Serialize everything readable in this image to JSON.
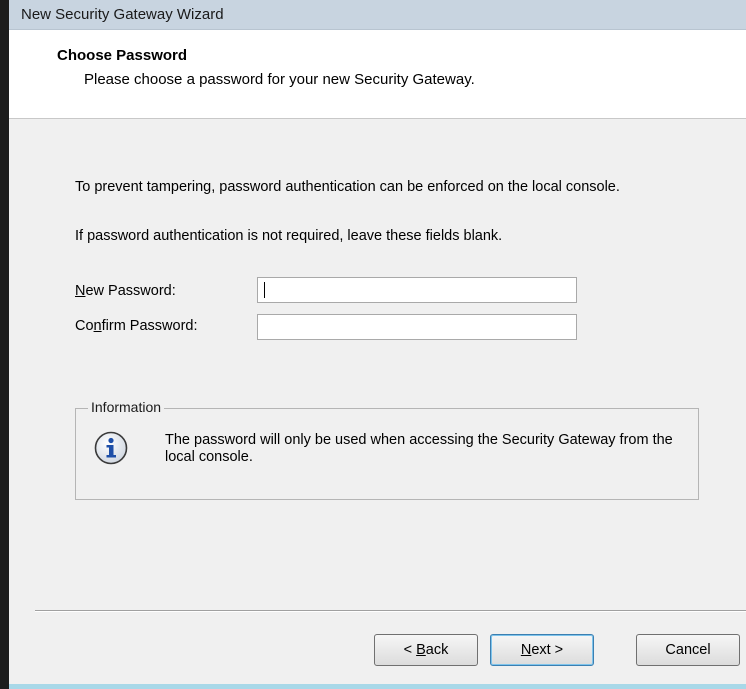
{
  "window": {
    "title": "New Security Gateway Wizard"
  },
  "header": {
    "title": "Choose Password",
    "subtitle": "Please choose a password for your new Security Gateway."
  },
  "body": {
    "line1": "To prevent tampering, password authentication can be enforced on the local console.",
    "line2": "If password authentication is not required, leave these fields blank."
  },
  "form": {
    "new_password": {
      "label_mnemonic": "N",
      "label_rest": "ew Password:",
      "value": ""
    },
    "confirm_password": {
      "label_prefix": "Co",
      "label_mnemonic": "n",
      "label_rest": "firm Password:",
      "value": ""
    }
  },
  "info": {
    "legend": "Information",
    "icon": "info-icon",
    "message": "The password will only be used when accessing the Security Gateway from the local console."
  },
  "buttons": {
    "back": {
      "prefix": "< ",
      "mnemonic": "B",
      "rest": "ack"
    },
    "next": {
      "mnemonic": "N",
      "rest": "ext >"
    },
    "cancel": {
      "label": "Cancel"
    }
  },
  "colors": {
    "title_bar": "#c8d4e0",
    "dialog_bg": "#f0f0f0",
    "info_icon_blue": "#1e4fa8",
    "default_button_border": "#3c7fb1"
  }
}
